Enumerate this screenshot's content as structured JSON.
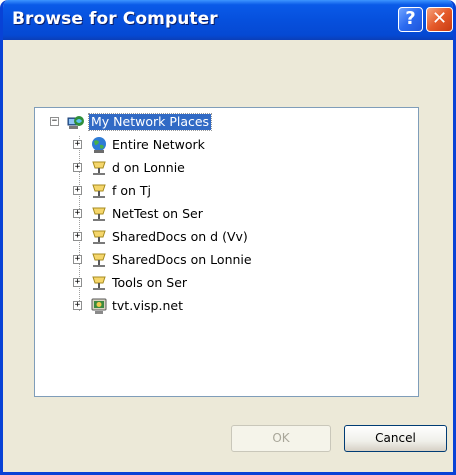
{
  "window": {
    "title": "Browse for Computer",
    "help_glyph": "?",
    "close_glyph": "✕"
  },
  "tree": {
    "root": {
      "label": "My Network Places",
      "icon": "network-places-icon",
      "expanded": true,
      "selected": true
    },
    "items": [
      {
        "label": "Entire Network",
        "icon": "globe-icon"
      },
      {
        "label": "d on Lonnie",
        "icon": "network-drive-icon"
      },
      {
        "label": "f on Tj",
        "icon": "network-drive-icon"
      },
      {
        "label": "NetTest on Ser",
        "icon": "network-drive-icon"
      },
      {
        "label": "SharedDocs on d (Vv)",
        "icon": "network-drive-icon"
      },
      {
        "label": "SharedDocs on Lonnie",
        "icon": "network-drive-icon"
      },
      {
        "label": "Tools on Ser",
        "icon": "network-drive-icon"
      },
      {
        "label": "tvt.visp.net",
        "icon": "computer-icon"
      }
    ],
    "expander_collapsed": "+",
    "expander_expanded": "−"
  },
  "buttons": {
    "ok_label": "OK",
    "ok_enabled": false,
    "cancel_label": "Cancel"
  },
  "colors": {
    "title_bar": "#0650DD",
    "selection": "#316AC5",
    "dialog_bg": "#ECE9D8"
  }
}
